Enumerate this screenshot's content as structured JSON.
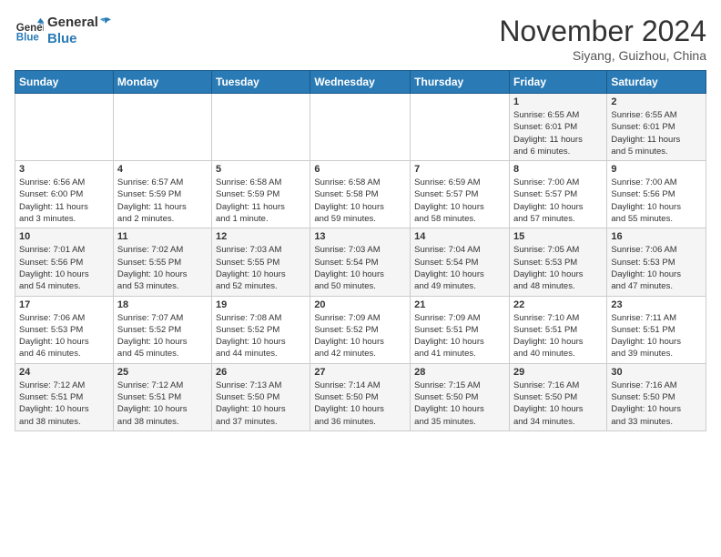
{
  "header": {
    "logo_line1": "General",
    "logo_line2": "Blue",
    "month": "November 2024",
    "location": "Siyang, Guizhou, China"
  },
  "weekdays": [
    "Sunday",
    "Monday",
    "Tuesday",
    "Wednesday",
    "Thursday",
    "Friday",
    "Saturday"
  ],
  "weeks": [
    [
      {
        "day": "",
        "info": ""
      },
      {
        "day": "",
        "info": ""
      },
      {
        "day": "",
        "info": ""
      },
      {
        "day": "",
        "info": ""
      },
      {
        "day": "",
        "info": ""
      },
      {
        "day": "1",
        "info": "Sunrise: 6:55 AM\nSunset: 6:01 PM\nDaylight: 11 hours\nand 6 minutes."
      },
      {
        "day": "2",
        "info": "Sunrise: 6:55 AM\nSunset: 6:01 PM\nDaylight: 11 hours\nand 5 minutes."
      }
    ],
    [
      {
        "day": "3",
        "info": "Sunrise: 6:56 AM\nSunset: 6:00 PM\nDaylight: 11 hours\nand 3 minutes."
      },
      {
        "day": "4",
        "info": "Sunrise: 6:57 AM\nSunset: 5:59 PM\nDaylight: 11 hours\nand 2 minutes."
      },
      {
        "day": "5",
        "info": "Sunrise: 6:58 AM\nSunset: 5:59 PM\nDaylight: 11 hours\nand 1 minute."
      },
      {
        "day": "6",
        "info": "Sunrise: 6:58 AM\nSunset: 5:58 PM\nDaylight: 10 hours\nand 59 minutes."
      },
      {
        "day": "7",
        "info": "Sunrise: 6:59 AM\nSunset: 5:57 PM\nDaylight: 10 hours\nand 58 minutes."
      },
      {
        "day": "8",
        "info": "Sunrise: 7:00 AM\nSunset: 5:57 PM\nDaylight: 10 hours\nand 57 minutes."
      },
      {
        "day": "9",
        "info": "Sunrise: 7:00 AM\nSunset: 5:56 PM\nDaylight: 10 hours\nand 55 minutes."
      }
    ],
    [
      {
        "day": "10",
        "info": "Sunrise: 7:01 AM\nSunset: 5:56 PM\nDaylight: 10 hours\nand 54 minutes."
      },
      {
        "day": "11",
        "info": "Sunrise: 7:02 AM\nSunset: 5:55 PM\nDaylight: 10 hours\nand 53 minutes."
      },
      {
        "day": "12",
        "info": "Sunrise: 7:03 AM\nSunset: 5:55 PM\nDaylight: 10 hours\nand 52 minutes."
      },
      {
        "day": "13",
        "info": "Sunrise: 7:03 AM\nSunset: 5:54 PM\nDaylight: 10 hours\nand 50 minutes."
      },
      {
        "day": "14",
        "info": "Sunrise: 7:04 AM\nSunset: 5:54 PM\nDaylight: 10 hours\nand 49 minutes."
      },
      {
        "day": "15",
        "info": "Sunrise: 7:05 AM\nSunset: 5:53 PM\nDaylight: 10 hours\nand 48 minutes."
      },
      {
        "day": "16",
        "info": "Sunrise: 7:06 AM\nSunset: 5:53 PM\nDaylight: 10 hours\nand 47 minutes."
      }
    ],
    [
      {
        "day": "17",
        "info": "Sunrise: 7:06 AM\nSunset: 5:53 PM\nDaylight: 10 hours\nand 46 minutes."
      },
      {
        "day": "18",
        "info": "Sunrise: 7:07 AM\nSunset: 5:52 PM\nDaylight: 10 hours\nand 45 minutes."
      },
      {
        "day": "19",
        "info": "Sunrise: 7:08 AM\nSunset: 5:52 PM\nDaylight: 10 hours\nand 44 minutes."
      },
      {
        "day": "20",
        "info": "Sunrise: 7:09 AM\nSunset: 5:52 PM\nDaylight: 10 hours\nand 42 minutes."
      },
      {
        "day": "21",
        "info": "Sunrise: 7:09 AM\nSunset: 5:51 PM\nDaylight: 10 hours\nand 41 minutes."
      },
      {
        "day": "22",
        "info": "Sunrise: 7:10 AM\nSunset: 5:51 PM\nDaylight: 10 hours\nand 40 minutes."
      },
      {
        "day": "23",
        "info": "Sunrise: 7:11 AM\nSunset: 5:51 PM\nDaylight: 10 hours\nand 39 minutes."
      }
    ],
    [
      {
        "day": "24",
        "info": "Sunrise: 7:12 AM\nSunset: 5:51 PM\nDaylight: 10 hours\nand 38 minutes."
      },
      {
        "day": "25",
        "info": "Sunrise: 7:12 AM\nSunset: 5:51 PM\nDaylight: 10 hours\nand 38 minutes."
      },
      {
        "day": "26",
        "info": "Sunrise: 7:13 AM\nSunset: 5:50 PM\nDaylight: 10 hours\nand 37 minutes."
      },
      {
        "day": "27",
        "info": "Sunrise: 7:14 AM\nSunset: 5:50 PM\nDaylight: 10 hours\nand 36 minutes."
      },
      {
        "day": "28",
        "info": "Sunrise: 7:15 AM\nSunset: 5:50 PM\nDaylight: 10 hours\nand 35 minutes."
      },
      {
        "day": "29",
        "info": "Sunrise: 7:16 AM\nSunset: 5:50 PM\nDaylight: 10 hours\nand 34 minutes."
      },
      {
        "day": "30",
        "info": "Sunrise: 7:16 AM\nSunset: 5:50 PM\nDaylight: 10 hours\nand 33 minutes."
      }
    ]
  ]
}
